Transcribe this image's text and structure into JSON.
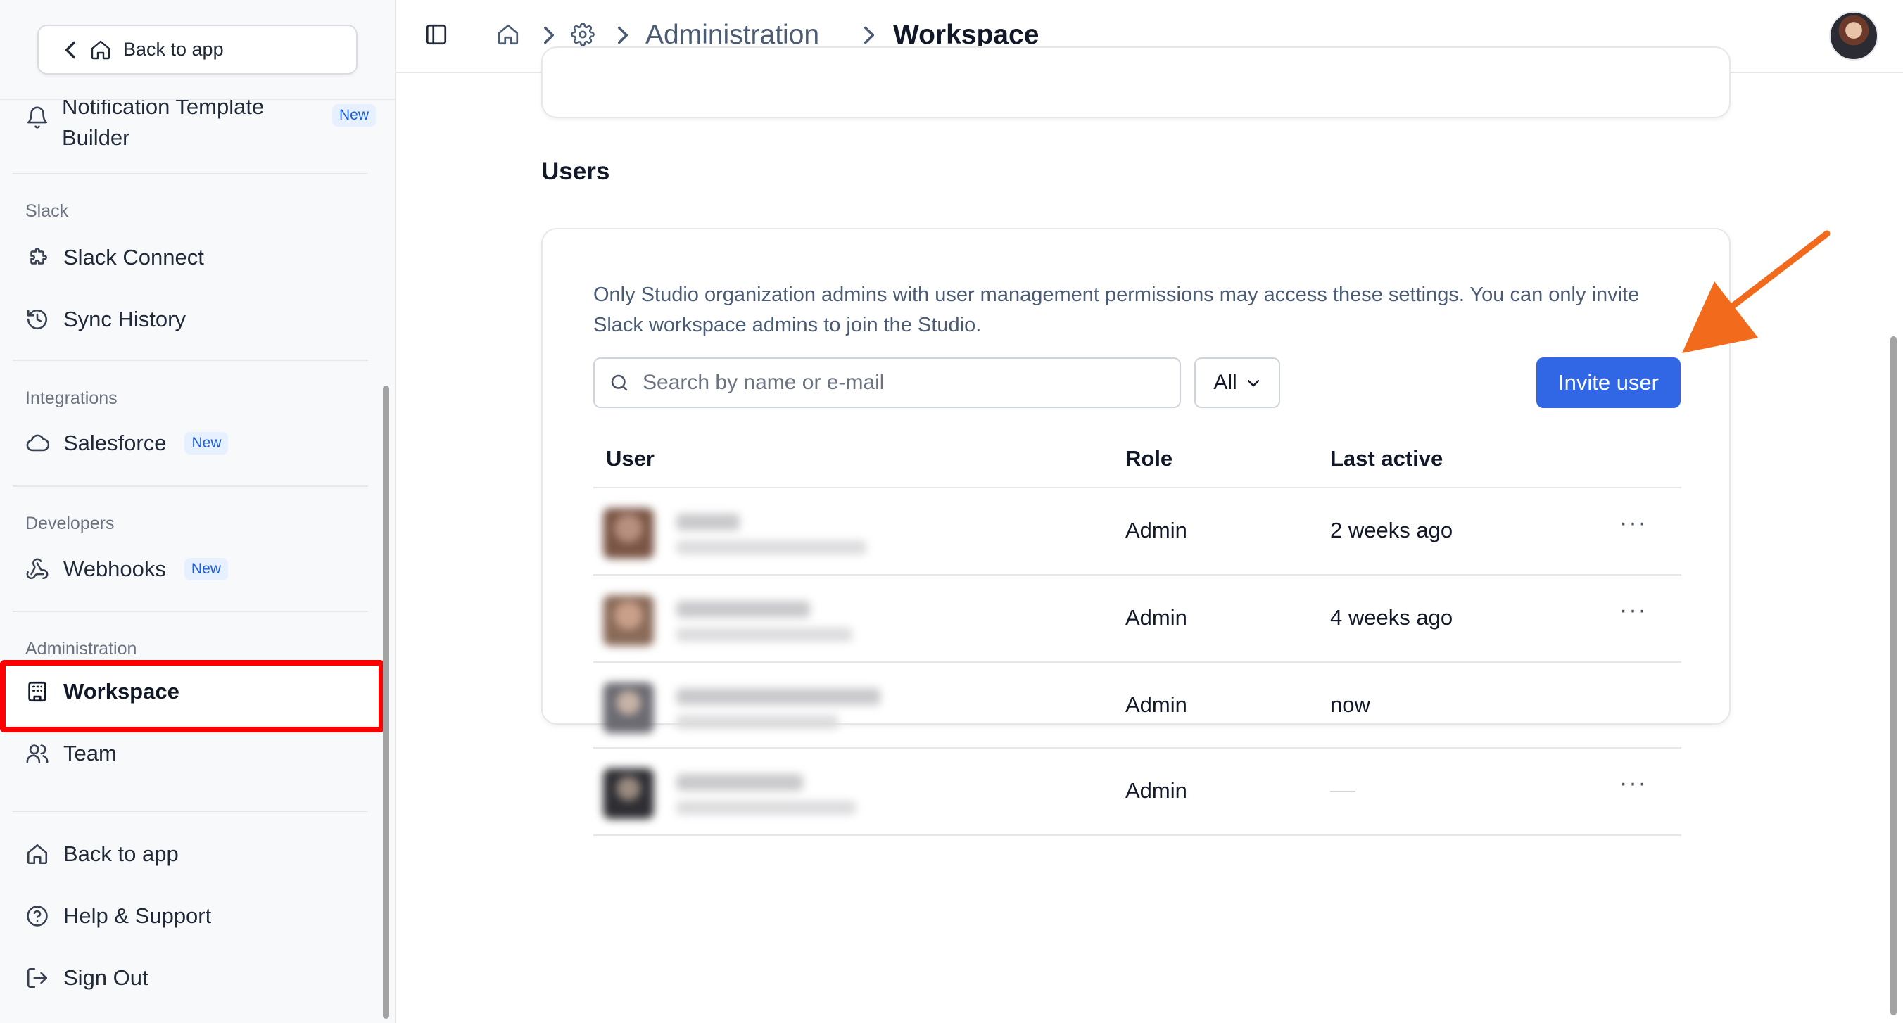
{
  "sidebar": {
    "back_top_label": "Back to app",
    "notification_item": {
      "label": "Notification Template Builder",
      "badge": "New"
    },
    "sections": {
      "slack": "Slack",
      "integrations": "Integrations",
      "developers": "Developers",
      "administration": "Administration"
    },
    "items": {
      "slack_connect": "Slack Connect",
      "sync_history": "Sync History",
      "salesforce": "Salesforce",
      "salesforce_badge": "New",
      "webhooks": "Webhooks",
      "webhooks_badge": "New",
      "workspace": "Workspace",
      "team": "Team"
    },
    "footer": {
      "back_to_app": "Back to app",
      "help_support": "Help & Support",
      "sign_out": "Sign Out"
    }
  },
  "breadcrumb": {
    "administration": "Administration",
    "workspace": "Workspace"
  },
  "main": {
    "section_title": "Users",
    "info_text": "Only Studio organization admins with user management permissions may access these settings. You can only invite Slack workspace admins to join the Studio.",
    "search": {
      "placeholder": "Search by name or e-mail",
      "value": ""
    },
    "filter": {
      "selected": "All"
    },
    "invite_button": "Invite user",
    "table": {
      "headers": {
        "user": "User",
        "role": "Role",
        "last_active": "Last active"
      },
      "rows": [
        {
          "role": "Admin",
          "last_active": "2 weeks ago",
          "more": "···"
        },
        {
          "role": "Admin",
          "last_active": "4 weeks ago",
          "more": "···"
        },
        {
          "role": "Admin",
          "last_active": "now",
          "more": ""
        },
        {
          "role": "Admin",
          "last_active": "—",
          "more": "···"
        }
      ]
    }
  },
  "colors": {
    "accent": "#3166e4",
    "highlight": "#ff0000",
    "arrow": "#f26b1d",
    "badge_bg": "#e6f0ff",
    "badge_text": "#1d5fd6"
  }
}
